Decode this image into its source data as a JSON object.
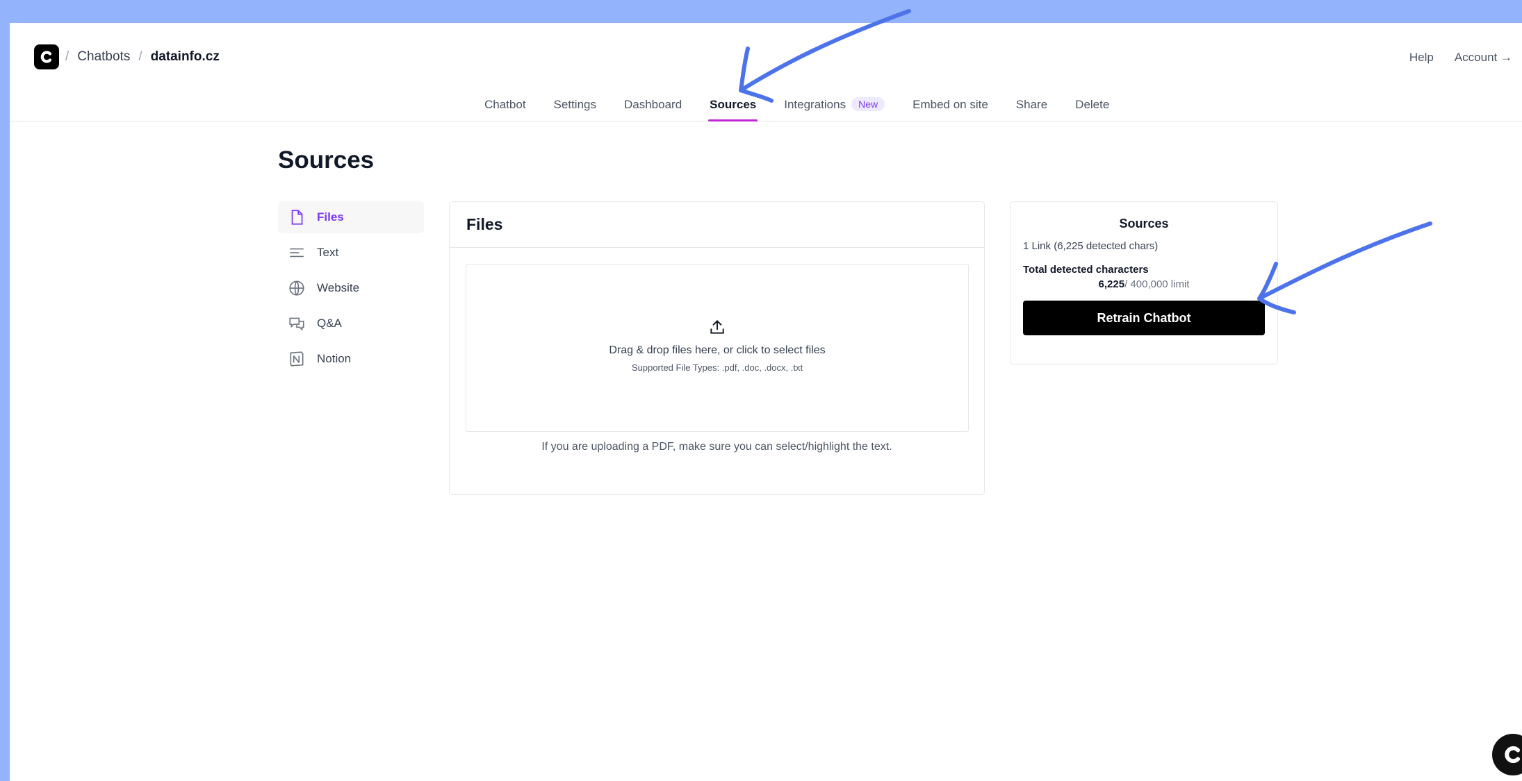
{
  "header": {
    "breadcrumbs": [
      "Chatbots",
      "datainfo.cz"
    ],
    "help": "Help",
    "account": "Account →"
  },
  "tabs": [
    {
      "label": "Chatbot"
    },
    {
      "label": "Settings"
    },
    {
      "label": "Dashboard"
    },
    {
      "label": "Sources",
      "active": true
    },
    {
      "label": "Integrations",
      "badge": "New"
    },
    {
      "label": "Embed on site"
    },
    {
      "label": "Share"
    },
    {
      "label": "Delete"
    }
  ],
  "page": {
    "title": "Sources"
  },
  "side_nav": [
    {
      "label": "Files",
      "icon": "file-icon",
      "active": true
    },
    {
      "label": "Text",
      "icon": "text-lines-icon"
    },
    {
      "label": "Website",
      "icon": "globe-icon"
    },
    {
      "label": "Q&A",
      "icon": "chat-bubbles-icon"
    },
    {
      "label": "Notion",
      "icon": "notion-icon"
    }
  ],
  "files_panel": {
    "title": "Files",
    "drop_text": "Drag & drop files here, or click to select files",
    "supported": "Supported File Types: .pdf, .doc, .docx, .txt",
    "pdf_note": "If you are uploading a PDF, make sure you can select/highlight the text."
  },
  "sources_panel": {
    "title": "Sources",
    "links": "1 Link (6,225 detected chars)",
    "total_label": "Total detected characters",
    "count": "6,225",
    "limit": "/ 400,000 limit",
    "retrain": "Retrain Chatbot"
  },
  "colors": {
    "background": "#93b3fc",
    "accent": "#7c3aed",
    "tab_underline": "#c026d3",
    "annotation_arrow": "#4d73ea"
  }
}
